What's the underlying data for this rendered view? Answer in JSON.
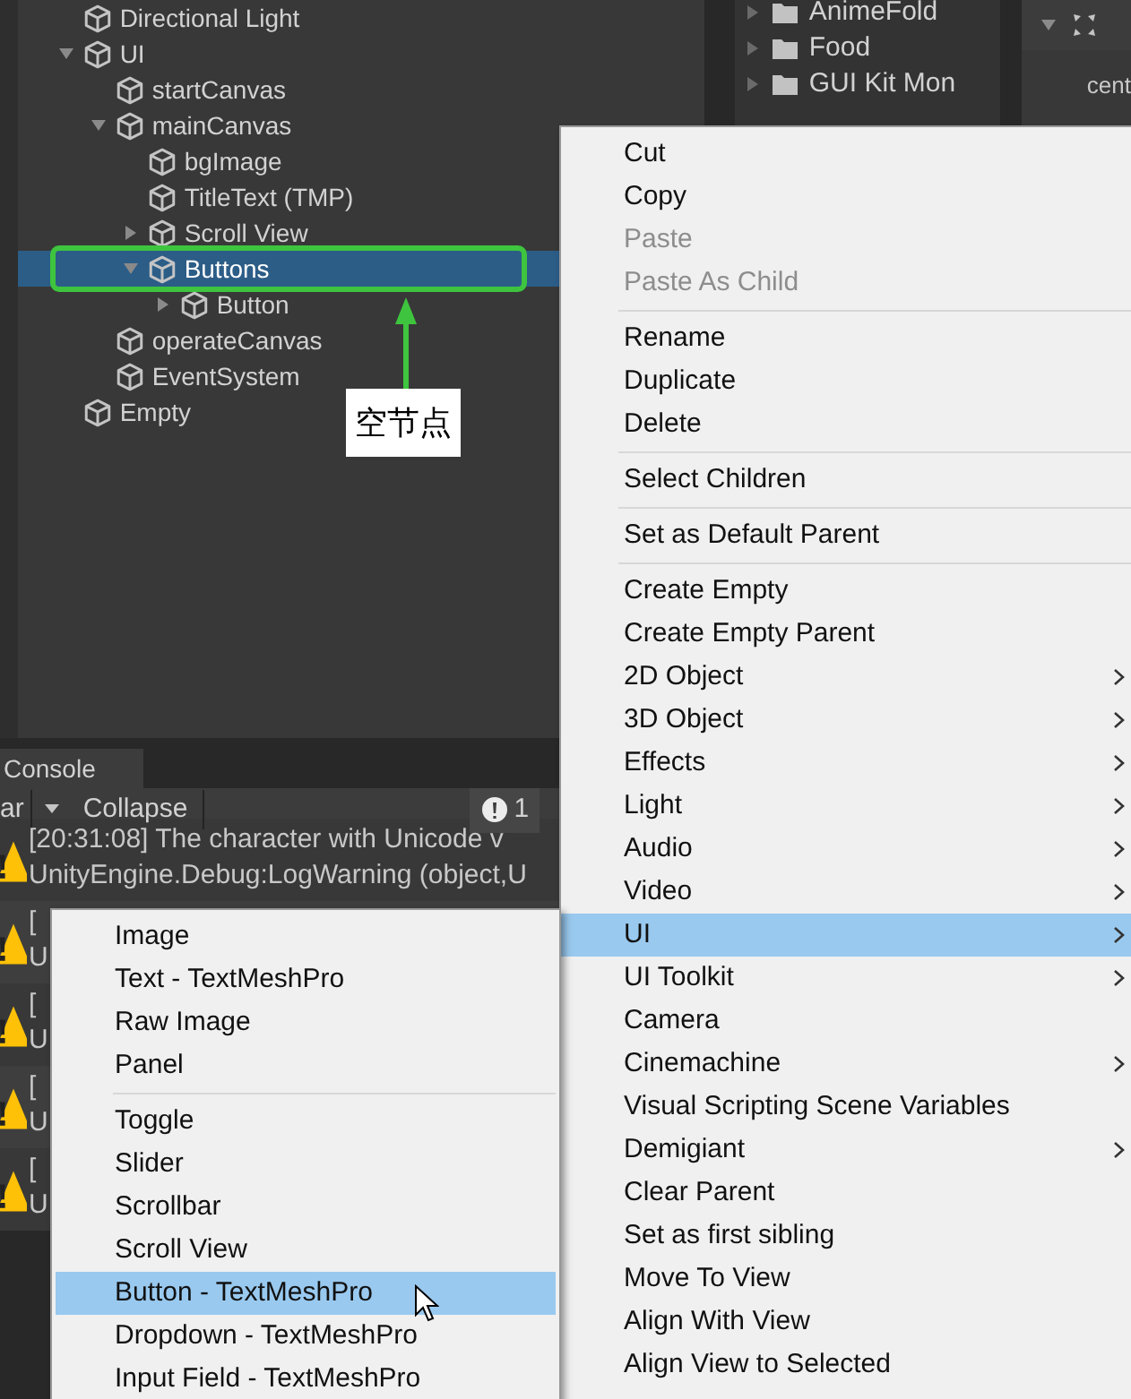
{
  "hierarchy": {
    "items": [
      {
        "name": "Directional Light"
      },
      {
        "name": "UI",
        "expanded": true,
        "selected": false,
        "children": [
          {
            "name": "startCanvas"
          },
          {
            "name": "mainCanvas",
            "expanded": true,
            "selected": false,
            "children": [
              {
                "name": "bgImage"
              },
              {
                "name": "TitleText (TMP)"
              },
              {
                "name": "Scroll View",
                "expanded": false,
                "selected": false
              },
              {
                "name": "Buttons",
                "expanded": true,
                "selected": true,
                "children": [
                  {
                    "name": "Button",
                    "expanded": false,
                    "selected": false
                  }
                ]
              }
            ]
          },
          {
            "name": "operateCanvas"
          },
          {
            "name": "EventSystem"
          }
        ]
      },
      {
        "name": "Empty"
      }
    ]
  },
  "annotation": {
    "label": "空节点"
  },
  "project": {
    "folders": [
      {
        "name": "AnimeFold"
      },
      {
        "name": "Food"
      },
      {
        "name": "GUI Kit Mon"
      }
    ]
  },
  "inspector": {
    "label": "cent"
  },
  "console": {
    "tab": "Console",
    "toolbar": {
      "clear": "ar",
      "collapse": "Collapse",
      "error_count": "1"
    },
    "logs": [
      {
        "lines": [
          "[20:31:08] The character with Unicode v",
          "UnityEngine.Debug:LogWarning (object,U"
        ]
      },
      {
        "lines": [
          "[",
          "U"
        ]
      },
      {
        "lines": [
          "[",
          "U"
        ]
      },
      {
        "lines": [
          "[",
          "U"
        ]
      },
      {
        "lines": [
          "[",
          "U"
        ]
      }
    ]
  },
  "context_menu": {
    "items": [
      {
        "kind": "item",
        "label": "Cut",
        "disabled": false,
        "selected": false,
        "submenu": false
      },
      {
        "kind": "item",
        "label": "Copy",
        "disabled": false,
        "selected": false,
        "submenu": false
      },
      {
        "kind": "item",
        "label": "Paste",
        "disabled": true,
        "selected": false,
        "submenu": false
      },
      {
        "kind": "item",
        "label": "Paste As Child",
        "disabled": true,
        "selected": false,
        "submenu": false
      },
      {
        "kind": "separator"
      },
      {
        "kind": "item",
        "label": "Rename",
        "disabled": false,
        "selected": false,
        "submenu": false
      },
      {
        "kind": "item",
        "label": "Duplicate",
        "disabled": false,
        "selected": false,
        "submenu": false
      },
      {
        "kind": "item",
        "label": "Delete",
        "disabled": false,
        "selected": false,
        "submenu": false
      },
      {
        "kind": "separator"
      },
      {
        "kind": "item",
        "label": "Select Children",
        "disabled": false,
        "selected": false,
        "submenu": false
      },
      {
        "kind": "separator"
      },
      {
        "kind": "item",
        "label": "Set as Default Parent",
        "disabled": false,
        "selected": false,
        "submenu": false
      },
      {
        "kind": "separator"
      },
      {
        "kind": "item",
        "label": "Create Empty",
        "disabled": false,
        "selected": false,
        "submenu": false
      },
      {
        "kind": "item",
        "label": "Create Empty Parent",
        "disabled": false,
        "selected": false,
        "submenu": false
      },
      {
        "kind": "item",
        "label": "2D Object",
        "disabled": false,
        "selected": false,
        "submenu": true
      },
      {
        "kind": "item",
        "label": "3D Object",
        "disabled": false,
        "selected": false,
        "submenu": true
      },
      {
        "kind": "item",
        "label": "Effects",
        "disabled": false,
        "selected": false,
        "submenu": true
      },
      {
        "kind": "item",
        "label": "Light",
        "disabled": false,
        "selected": false,
        "submenu": true
      },
      {
        "kind": "item",
        "label": "Audio",
        "disabled": false,
        "selected": false,
        "submenu": true
      },
      {
        "kind": "item",
        "label": "Video",
        "disabled": false,
        "selected": false,
        "submenu": true
      },
      {
        "kind": "item",
        "label": "UI",
        "disabled": false,
        "selected": true,
        "submenu": true
      },
      {
        "kind": "item",
        "label": "UI Toolkit",
        "disabled": false,
        "selected": false,
        "submenu": true
      },
      {
        "kind": "item",
        "label": "Camera",
        "disabled": false,
        "selected": false,
        "submenu": false
      },
      {
        "kind": "item",
        "label": "Cinemachine",
        "disabled": false,
        "selected": false,
        "submenu": true
      },
      {
        "kind": "item",
        "label": "Visual Scripting Scene Variables",
        "disabled": false,
        "selected": false,
        "submenu": false
      },
      {
        "kind": "item",
        "label": "Demigiant",
        "disabled": false,
        "selected": false,
        "submenu": true
      },
      {
        "kind": "item",
        "label": "Clear Parent",
        "disabled": false,
        "selected": false,
        "submenu": false
      },
      {
        "kind": "item",
        "label": "Set as first sibling",
        "disabled": false,
        "selected": false,
        "submenu": false
      },
      {
        "kind": "item",
        "label": "Move To View",
        "disabled": false,
        "selected": false,
        "submenu": false
      },
      {
        "kind": "item",
        "label": "Align With View",
        "disabled": false,
        "selected": false,
        "submenu": false
      },
      {
        "kind": "item",
        "label": "Align View to Selected",
        "disabled": false,
        "selected": false,
        "submenu": false
      }
    ]
  },
  "submenu": {
    "items": [
      {
        "kind": "item",
        "label": "Image",
        "selected": false
      },
      {
        "kind": "item",
        "label": "Text - TextMeshPro",
        "selected": false
      },
      {
        "kind": "item",
        "label": "Raw Image",
        "selected": false
      },
      {
        "kind": "item",
        "label": "Panel",
        "selected": false
      },
      {
        "kind": "separator"
      },
      {
        "kind": "item",
        "label": "Toggle",
        "selected": false
      },
      {
        "kind": "item",
        "label": "Slider",
        "selected": false
      },
      {
        "kind": "item",
        "label": "Scrollbar",
        "selected": false
      },
      {
        "kind": "item",
        "label": "Scroll View",
        "selected": false
      },
      {
        "kind": "item",
        "label": "Button - TextMeshPro",
        "selected": true
      },
      {
        "kind": "item",
        "label": "Dropdown - TextMeshPro",
        "selected": false
      },
      {
        "kind": "item",
        "label": "Input Field - TextMeshPro",
        "selected": false
      }
    ]
  }
}
